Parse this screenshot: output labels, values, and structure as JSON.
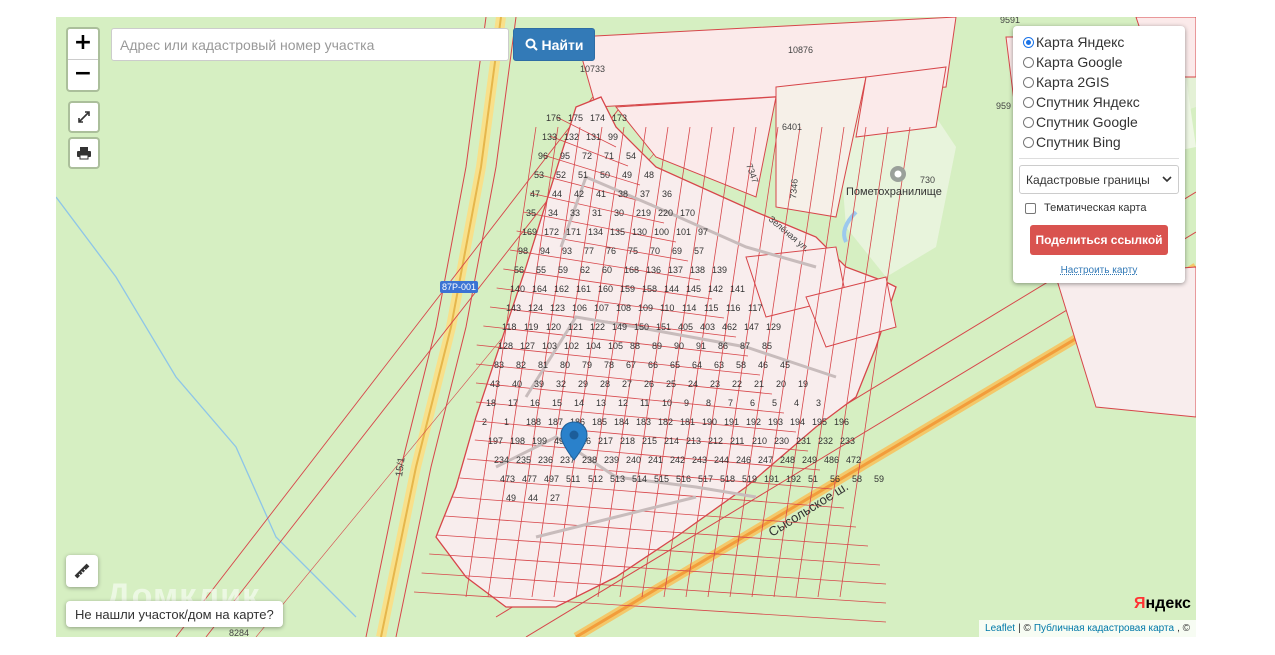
{
  "search": {
    "placeholder": "Адрес или кадастровый номер участка",
    "button_label": "Найти"
  },
  "zoom": {
    "in_label": "+",
    "out_label": "−"
  },
  "layers": {
    "options": [
      {
        "label": "Карта Яндекс",
        "selected": true
      },
      {
        "label": "Карта Google",
        "selected": false
      },
      {
        "label": "Карта 2GIS",
        "selected": false
      },
      {
        "label": "Спутник Яндекс",
        "selected": false
      },
      {
        "label": "Спутник Google",
        "selected": false
      },
      {
        "label": "Спутник Bing",
        "selected": false
      }
    ],
    "overlay_select": "Кадастровые границы",
    "thematic_label": "Тематическая карта",
    "share_button": "Поделиться ссылкой",
    "settings_link": "Настроить карту"
  },
  "not_found_label": "Не нашли участок/дом на карте?",
  "attribution": {
    "leaflet": "Leaflet",
    "separator": "| ©",
    "cadastral": "Публичная кадастровая карта",
    "suffix": ", ©"
  },
  "yandex_logo": "Яндекс",
  "map_labels": {
    "road_main": "Сысольское ш.",
    "road_code": "87Р-001",
    "road_15": "15/1",
    "poi": "Пометохранилище",
    "street_green": "Зелёная ул.",
    "parcel_6401": "6401",
    "parcel_7347": "7347",
    "parcel_7346": "7346",
    "parcel_730": "730",
    "parcel_10876": "10876",
    "parcel_10733": "10733",
    "parcel_9591": "9591",
    "parcel_8284": "8284",
    "parcel_959": "959"
  },
  "parcel_numbers": [
    "176",
    "175",
    "174",
    "173",
    "133",
    "132",
    "131",
    "99",
    "96",
    "95",
    "72",
    "71",
    "54",
    "53",
    "52",
    "51",
    "50",
    "49",
    "48",
    "47",
    "44",
    "42",
    "41",
    "38",
    "37",
    "36",
    "35",
    "34",
    "33",
    "31",
    "30",
    "219",
    "220",
    "170",
    "169",
    "172",
    "171",
    "134",
    "135",
    "130",
    "100",
    "101",
    "97",
    "98",
    "94",
    "93",
    "77",
    "76",
    "75",
    "70",
    "69",
    "57",
    "56",
    "55",
    "59",
    "62",
    "60",
    "168",
    "136",
    "137",
    "138",
    "139",
    "140",
    "164",
    "162",
    "161",
    "160",
    "159",
    "158",
    "144",
    "145",
    "142",
    "141",
    "143",
    "124",
    "123",
    "106",
    "107",
    "108",
    "109",
    "110",
    "114",
    "115",
    "116",
    "117",
    "118",
    "119",
    "120",
    "121",
    "122",
    "149",
    "150",
    "151",
    "405",
    "403",
    "462",
    "147",
    "129",
    "128",
    "127",
    "103",
    "102",
    "104",
    "105",
    "88",
    "89",
    "90",
    "91",
    "86",
    "87",
    "85",
    "83",
    "82",
    "81",
    "80",
    "79",
    "78",
    "67",
    "66",
    "65",
    "64",
    "63",
    "58",
    "46",
    "45",
    "43",
    "40",
    "39",
    "32",
    "29",
    "28",
    "27",
    "26",
    "25",
    "24",
    "23",
    "22",
    "21",
    "20",
    "19",
    "18",
    "17",
    "16",
    "15",
    "14",
    "13",
    "12",
    "11",
    "10",
    "9",
    "8",
    "7",
    "6",
    "5",
    "4",
    "3",
    "2",
    "1",
    "188",
    "187",
    "186",
    "185",
    "184",
    "183",
    "182",
    "181",
    "190",
    "191",
    "192",
    "193",
    "194",
    "195",
    "196",
    "197",
    "198",
    "199",
    "495",
    "216",
    "217",
    "218",
    "215",
    "214",
    "213",
    "212",
    "211",
    "210",
    "230",
    "231",
    "232",
    "233",
    "234",
    "235",
    "236",
    "237",
    "238",
    "239",
    "240",
    "241",
    "242",
    "243",
    "244",
    "246",
    "247",
    "248",
    "249",
    "486",
    "472",
    "473",
    "477",
    "497",
    "511",
    "512",
    "513",
    "514",
    "515",
    "516",
    "517",
    "518",
    "519",
    "191",
    "192",
    "51",
    "56",
    "58",
    "59",
    "49",
    "44",
    "27"
  ]
}
